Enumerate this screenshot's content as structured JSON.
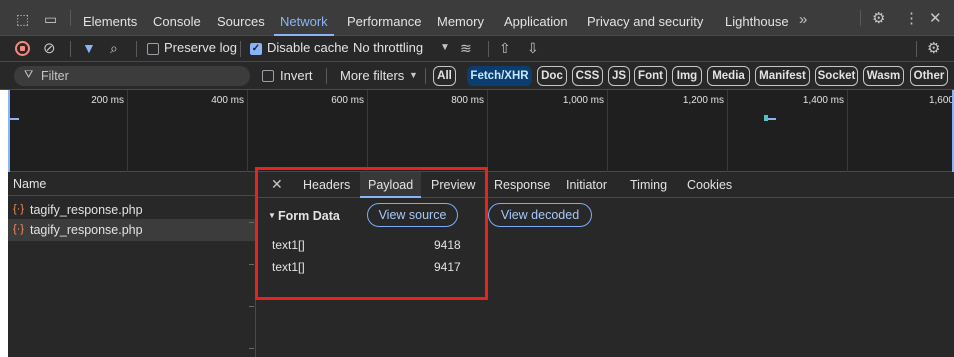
{
  "main_tabs": [
    "Elements",
    "Console",
    "Sources",
    "Network",
    "Performance",
    "Memory",
    "Application",
    "Privacy and security",
    "Lighthouse"
  ],
  "active_main_tab": "Network",
  "toolbar": {
    "preserve_log_label": "Preserve log",
    "preserve_log_checked": false,
    "disable_cache_label": "Disable cache",
    "disable_cache_checked": true,
    "throttling_value": "No throttling"
  },
  "filter": {
    "placeholder": "Filter",
    "invert_label": "Invert",
    "more_filters_label": "More filters",
    "chips": [
      "All",
      "Fetch/XHR",
      "Doc",
      "CSS",
      "JS",
      "Font",
      "Img",
      "Media",
      "Manifest",
      "Socket",
      "Wasm",
      "Other"
    ],
    "active_chip": "Fetch/XHR"
  },
  "timeline": {
    "tick_labels": [
      "200 ms",
      "400 ms",
      "600 ms",
      "800 ms",
      "1,000 ms",
      "1,200 ms",
      "1,400 ms",
      "1,600"
    ]
  },
  "requests": {
    "header": "Name",
    "rows": [
      {
        "name": "tagify_response.php"
      },
      {
        "name": "tagify_response.php"
      }
    ],
    "selected_index": 1
  },
  "detail": {
    "tabs": [
      "Headers",
      "Payload",
      "Preview",
      "Response",
      "Initiator",
      "Timing",
      "Cookies"
    ],
    "active_tab": "Payload",
    "section_title": "Form Data",
    "view_source_label": "View source",
    "view_decoded_label": "View decoded",
    "form_data": [
      {
        "key": "text1[]",
        "value": "9418"
      },
      {
        "key": "text1[]",
        "value": "9417"
      }
    ]
  },
  "colors": {
    "accent": "#8ab4f8",
    "highlight_box": "#e8221c",
    "request_icon": "#f28b54"
  }
}
